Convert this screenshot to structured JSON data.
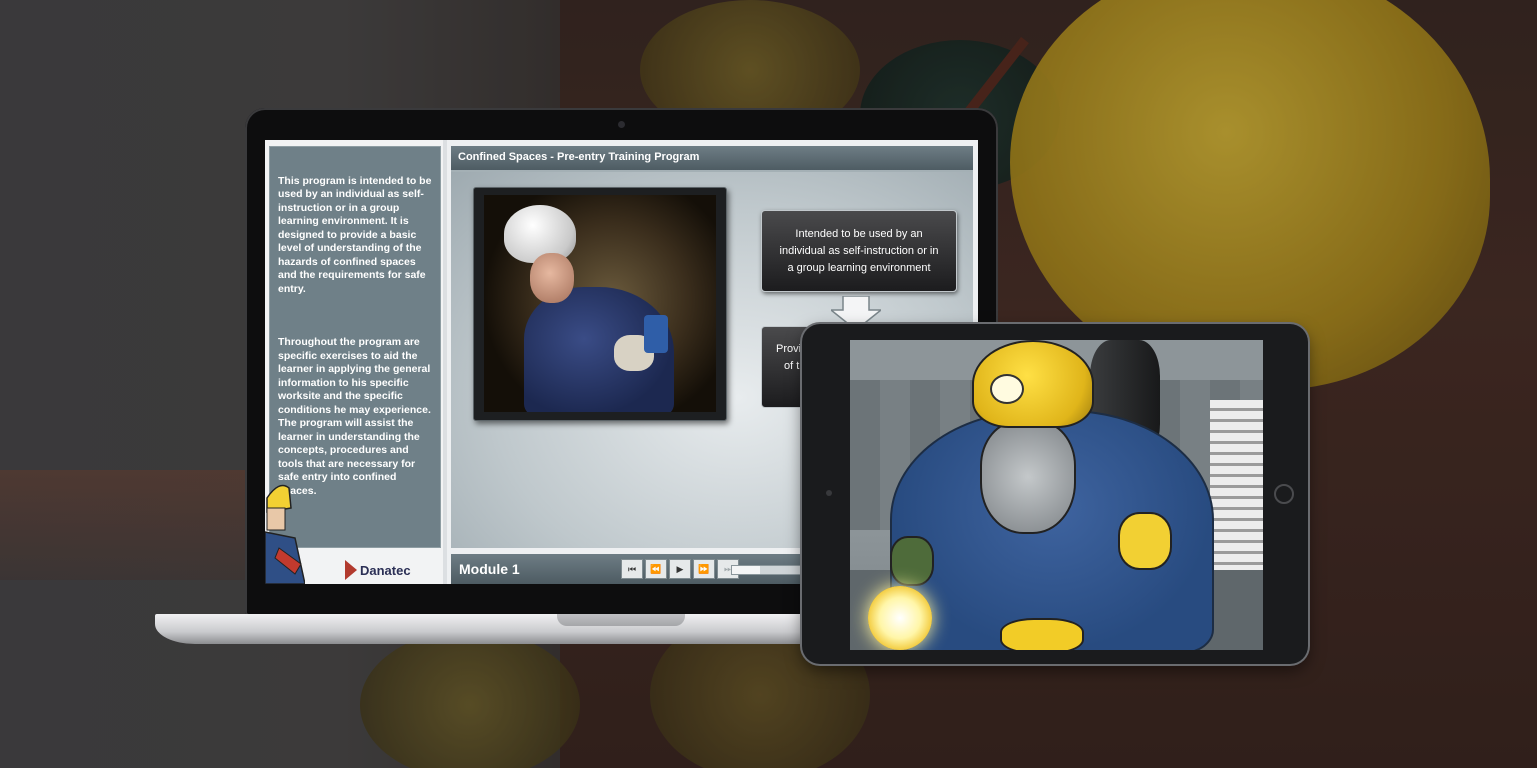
{
  "laptop_app": {
    "sidebar": {
      "paragraph_1": "This program is intended to be used by an individual as self-instruction or in a group learning environment. It is designed to provide a basic level of understanding of the hazards of confined spaces and the requirements for safe entry.",
      "paragraph_2": "Throughout the program are specific exercises to aid the learner in applying the general information to his specific worksite and the specific conditions he may experience. The program will assist the learner in understanding the concepts, procedures and tools that are necessary for safe entry into confined spaces.",
      "brand": "Danatec"
    },
    "header": {
      "title": "Confined Spaces - Pre-entry Training Program"
    },
    "content": {
      "box_1": "Intended to be used by an individual as self-instruction or in a group learning environment",
      "box_2_partial_line_1": "Provid",
      "box_2_partial_line_2": "of t"
    },
    "footer": {
      "module_title": "Module 1",
      "controls": [
        {
          "icon": "skip-to-start-icon",
          "glyph": "⏮",
          "disabled": false
        },
        {
          "icon": "rewind-icon",
          "glyph": "⏪",
          "disabled": false
        },
        {
          "icon": "play-icon",
          "glyph": "▶",
          "disabled": false
        },
        {
          "icon": "fast-forward-icon",
          "glyph": "⏩",
          "disabled": true
        },
        {
          "icon": "skip-to-end-icon",
          "glyph": "⏭",
          "disabled": true
        }
      ],
      "progress": 0.35
    }
  },
  "colors": {
    "panel": "#6f8088",
    "title_bar": "#5b6a71",
    "brand_red": "#b23a2e",
    "brand_navy": "#2b2f55",
    "helmet_yellow": "#f2d033"
  }
}
